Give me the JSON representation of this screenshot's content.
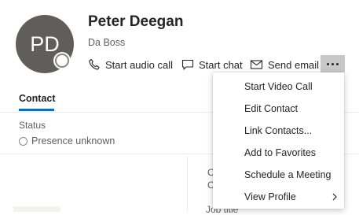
{
  "profile": {
    "initials": "PD",
    "name": "Peter Deegan",
    "subtitle": "Da Boss"
  },
  "actions": {
    "audio_call": "Start audio call",
    "chat": "Start chat",
    "email": "Send email"
  },
  "tabs": [
    {
      "label": "Contact",
      "active": true
    }
  ],
  "status": {
    "label": "Status",
    "value": "Presence unknown"
  },
  "details": {
    "line1": "C",
    "line2": "C",
    "job_title": "Job title"
  },
  "menu": {
    "items": [
      {
        "label": "Start Video Call"
      },
      {
        "label": "Edit Contact"
      },
      {
        "label": "Link Contacts..."
      },
      {
        "label": "Add to Favorites"
      },
      {
        "label": "Schedule a Meeting"
      },
      {
        "label": "View Profile",
        "has_submenu": true
      }
    ]
  },
  "colors": {
    "accent": "#0f6cbd",
    "avatar_bg": "#605e5c",
    "more_button_active": "#c8c8c8"
  }
}
